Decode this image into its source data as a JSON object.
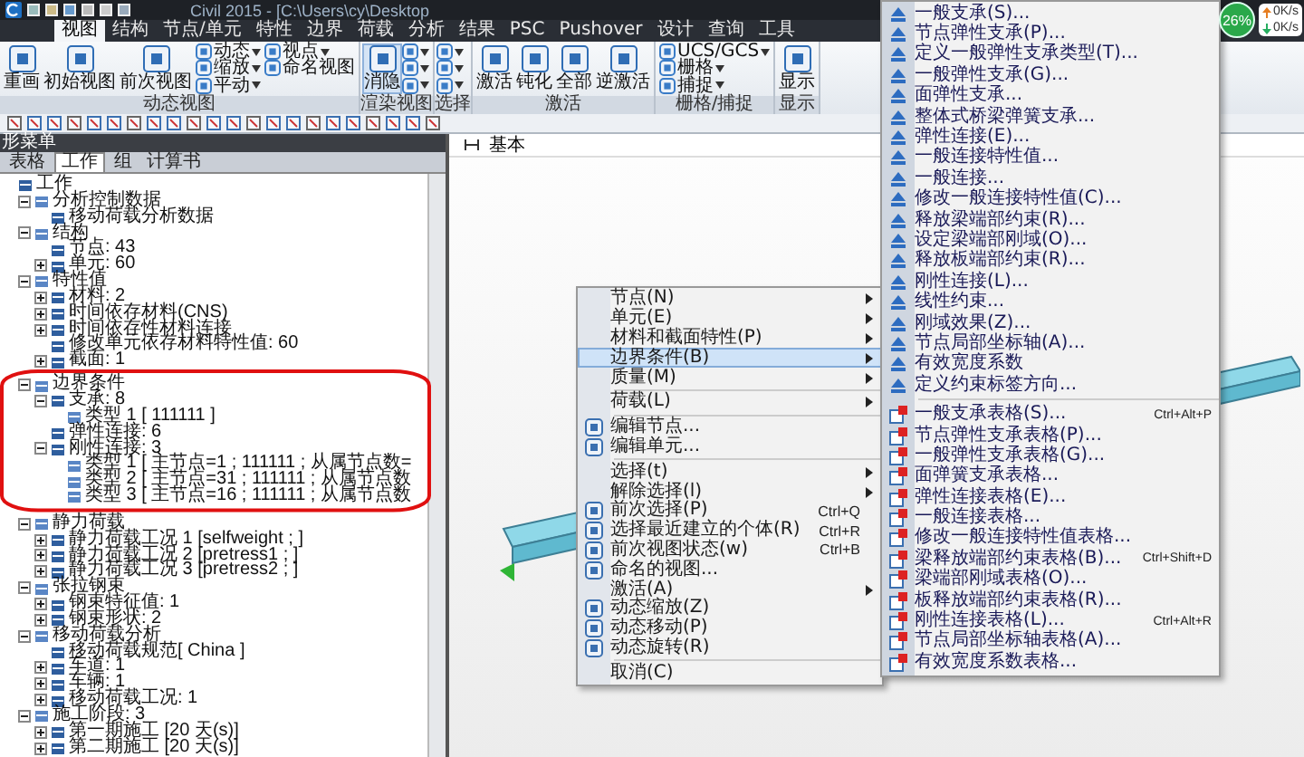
{
  "window": {
    "title": "Civil 2015 - [C:\\Users\\cy\\Desktop"
  },
  "system_widget": {
    "load": "26%",
    "upload": "0K/s",
    "download": "0K/s"
  },
  "ribbon": {
    "tabs": [
      {
        "label": "视图",
        "selected": true
      },
      {
        "label": "结构",
        "selected": false
      },
      {
        "label": "节点/单元",
        "selected": false
      },
      {
        "label": "特性",
        "selected": false
      },
      {
        "label": "边界",
        "selected": false
      },
      {
        "label": "荷载",
        "selected": false
      },
      {
        "label": "分析",
        "selected": false
      },
      {
        "label": "结果",
        "selected": false
      },
      {
        "label": "PSC",
        "selected": false
      },
      {
        "label": "Pushover",
        "selected": false
      },
      {
        "label": "设计",
        "selected": false
      },
      {
        "label": "查询",
        "selected": false
      },
      {
        "label": "工具",
        "selected": false
      }
    ],
    "groups": [
      {
        "label": "动态视图",
        "items": [
          {
            "kind": "large",
            "label": "重画",
            "selected": false
          },
          {
            "kind": "large",
            "label": "初始视图",
            "selected": false
          },
          {
            "kind": "large",
            "label": "前次视图",
            "selected": false
          },
          {
            "kind": "small",
            "label": "动态",
            "dropdown": true
          },
          {
            "kind": "small",
            "label": "缩放",
            "dropdown": true
          },
          {
            "kind": "small",
            "label": "平动",
            "dropdown": true
          },
          {
            "kind": "small",
            "label": "视点",
            "dropdown": true
          },
          {
            "kind": "small",
            "label": "命名视图",
            "dropdown": false
          }
        ]
      },
      {
        "label": "渲染视图",
        "items": [
          {
            "kind": "large",
            "label": "消隐",
            "selected": true
          },
          {
            "kind": "icon"
          },
          {
            "kind": "icon"
          },
          {
            "kind": "icon"
          }
        ]
      },
      {
        "label": "选择",
        "items": [
          {
            "kind": "icon"
          },
          {
            "kind": "icon"
          },
          {
            "kind": "icon"
          }
        ]
      },
      {
        "label": "激活",
        "items": [
          {
            "kind": "large",
            "label": "激活",
            "selected": false
          },
          {
            "kind": "large",
            "label": "钝化",
            "selected": false
          },
          {
            "kind": "large",
            "label": "全部",
            "selected": false
          },
          {
            "kind": "large",
            "label": "逆激活",
            "selected": false
          }
        ]
      },
      {
        "label": "栅格/捕捉",
        "items": [
          {
            "kind": "small",
            "label": "UCS/GCS",
            "dropdown": true
          },
          {
            "kind": "small",
            "label": "栅格",
            "dropdown": true
          },
          {
            "kind": "small",
            "label": "捕捉",
            "dropdown": true
          }
        ]
      },
      {
        "label": "显示",
        "items": [
          {
            "kind": "large",
            "label": "显示",
            "selected": false
          }
        ]
      }
    ]
  },
  "left_panel": {
    "title": "形菜单",
    "tabs": [
      {
        "label": "表格",
        "selected": false
      },
      {
        "label": "工作",
        "selected": true
      },
      {
        "label": "组",
        "selected": false
      },
      {
        "label": "计算书",
        "selected": false
      }
    ],
    "tree": [
      {
        "label": "工作",
        "children": [
          {
            "label": "分析控制数据",
            "expanded": true,
            "highlighted": false,
            "children": [
              {
                "label": "移动荷载分析数据"
              }
            ]
          },
          {
            "label": "结构",
            "expanded": true,
            "highlighted": false,
            "children": [
              {
                "label": "节点: 43"
              },
              {
                "label": "单元: 60",
                "expanded": false
              }
            ]
          },
          {
            "label": "特性值",
            "expanded": true,
            "highlighted": false,
            "children": [
              {
                "label": "材料: 2",
                "expanded": false
              },
              {
                "label": "时间依存材料(CNS)",
                "expanded": false
              },
              {
                "label": "时间依存性材料连接",
                "expanded": false
              },
              {
                "label": "修改单元依存材料特性值: 60"
              },
              {
                "label": "截面: 1",
                "expanded": false
              }
            ]
          },
          {
            "label": "边界条件",
            "expanded": true,
            "highlighted": true,
            "children": [
              {
                "label": "支承: 8",
                "expanded": true,
                "children": [
                  {
                    "label": "类型 1 [ 111111 ]"
                  }
                ]
              },
              {
                "label": "弹性连接: 6"
              },
              {
                "label": "刚性连接: 3",
                "expanded": true,
                "children": [
                  {
                    "label": "类型 1 [ 主节点=1 ; 111111 ; 从属节点数="
                  },
                  {
                    "label": "类型 2 [ 主节点=31 ; 111111 ; 从属节点数"
                  },
                  {
                    "label": "类型 3 [ 主节点=16 ; 111111 ; 从属节点数"
                  }
                ]
              }
            ]
          },
          {
            "label": "静力荷载",
            "expanded": true,
            "highlighted": false,
            "children": [
              {
                "label": "静力荷载工况 1 [selfweight ; ]",
                "expanded": false
              },
              {
                "label": "静力荷载工况 2 [pretress1 ; ]",
                "expanded": false
              },
              {
                "label": "静力荷载工况 3 [pretress2 ; ]",
                "expanded": false
              }
            ]
          },
          {
            "label": "张拉钢束",
            "expanded": true,
            "highlighted": false,
            "children": [
              {
                "label": "钢束特征值: 1",
                "expanded": false
              },
              {
                "label": "钢束形状: 2",
                "expanded": false
              }
            ]
          },
          {
            "label": "移动荷载分析",
            "expanded": true,
            "highlighted": false,
            "children": [
              {
                "label": "移动荷载规范[ China ]"
              },
              {
                "label": "车道: 1",
                "expanded": false
              },
              {
                "label": "车辆: 1",
                "expanded": false
              },
              {
                "label": "移动荷载工况: 1",
                "expanded": false
              }
            ]
          },
          {
            "label": "施工阶段: 3",
            "expanded": true,
            "highlighted": false,
            "children": [
              {
                "label": "第一期施工 [20 天(s)]",
                "expanded": false
              },
              {
                "label": "第二期施工 [20 天(s)]",
                "expanded": false
              }
            ]
          }
        ]
      }
    ]
  },
  "viewport": {
    "tab": "基本"
  },
  "context_menu": {
    "items": [
      {
        "kind": "item",
        "label": "节点(N)",
        "submenu": true,
        "icon": false,
        "selected": false
      },
      {
        "kind": "item",
        "label": "单元(E)",
        "submenu": true,
        "icon": false,
        "selected": false
      },
      {
        "kind": "item",
        "label": "材料和截面特性(P)",
        "submenu": true,
        "icon": false,
        "selected": false
      },
      {
        "kind": "item",
        "label": "边界条件(B)",
        "submenu": true,
        "icon": false,
        "selected": true
      },
      {
        "kind": "item",
        "label": "质量(M)",
        "submenu": true,
        "icon": false,
        "selected": false
      },
      {
        "kind": "separator"
      },
      {
        "kind": "item",
        "label": "荷载(L)",
        "submenu": true,
        "icon": false,
        "selected": false
      },
      {
        "kind": "separator"
      },
      {
        "kind": "item",
        "label": "编辑节点...",
        "submenu": false,
        "icon": true,
        "selected": false
      },
      {
        "kind": "item",
        "label": "编辑单元...",
        "submenu": false,
        "icon": true,
        "selected": false
      },
      {
        "kind": "separator"
      },
      {
        "kind": "item",
        "label": "选择(t)",
        "submenu": true,
        "icon": false,
        "selected": false
      },
      {
        "kind": "item",
        "label": "解除选择(l)",
        "submenu": true,
        "icon": false,
        "selected": false
      },
      {
        "kind": "item",
        "label": "前次选择(P)",
        "shortcut": "Ctrl+Q",
        "submenu": false,
        "icon": true,
        "selected": false
      },
      {
        "kind": "item",
        "label": "选择最近建立的个体(R)",
        "shortcut": "Ctrl+R",
        "submenu": false,
        "icon": true,
        "selected": false
      },
      {
        "kind": "item",
        "label": "前次视图状态(w)",
        "shortcut": "Ctrl+B",
        "submenu": false,
        "icon": true,
        "selected": false
      },
      {
        "kind": "item",
        "label": "命名的视图...",
        "submenu": false,
        "icon": true,
        "selected": false
      },
      {
        "kind": "item",
        "label": "激活(A)",
        "submenu": true,
        "icon": false,
        "selected": false
      },
      {
        "kind": "item",
        "label": "动态缩放(Z)",
        "submenu": false,
        "icon": true,
        "selected": false
      },
      {
        "kind": "item",
        "label": "动态移动(P)",
        "submenu": false,
        "icon": true,
        "selected": false
      },
      {
        "kind": "item",
        "label": "动态旋转(R)",
        "submenu": false,
        "icon": true,
        "selected": false
      },
      {
        "kind": "separator"
      },
      {
        "kind": "item",
        "label": "取消(C)",
        "submenu": false,
        "icon": false,
        "selected": false
      }
    ]
  },
  "submenu": {
    "items": [
      {
        "kind": "item",
        "label": "一般支承(S)..."
      },
      {
        "kind": "item",
        "label": "节点弹性支承(P)..."
      },
      {
        "kind": "item",
        "label": "定义一般弹性支承类型(T)..."
      },
      {
        "kind": "item",
        "label": "一般弹性支承(G)..."
      },
      {
        "kind": "item",
        "label": "面弹性支承..."
      },
      {
        "kind": "item",
        "label": "整体式桥梁弹簧支承..."
      },
      {
        "kind": "item",
        "label": "弹性连接(E)..."
      },
      {
        "kind": "item",
        "label": "一般连接特性值..."
      },
      {
        "kind": "item",
        "label": "一般连接..."
      },
      {
        "kind": "item",
        "label": "修改一般连接特性值(C)..."
      },
      {
        "kind": "item",
        "label": "释放梁端部约束(R)..."
      },
      {
        "kind": "item",
        "label": "设定梁端部刚域(O)..."
      },
      {
        "kind": "item",
        "label": "释放板端部约束(R)..."
      },
      {
        "kind": "item",
        "label": "刚性连接(L)..."
      },
      {
        "kind": "item",
        "label": "线性约束..."
      },
      {
        "kind": "item",
        "label": "刚域效果(Z)..."
      },
      {
        "kind": "item",
        "label": "节点局部坐标轴(A)..."
      },
      {
        "kind": "item",
        "label": "有效宽度系数"
      },
      {
        "kind": "item",
        "label": "定义约束标签方向..."
      },
      {
        "kind": "separator"
      },
      {
        "kind": "item",
        "label": "一般支承表格(S)...",
        "shortcut": "Ctrl+Alt+P"
      },
      {
        "kind": "item",
        "label": "节点弹性支承表格(P)..."
      },
      {
        "kind": "item",
        "label": "一般弹性支承表格(G)..."
      },
      {
        "kind": "item",
        "label": "面弹簧支承表格..."
      },
      {
        "kind": "item",
        "label": "弹性连接表格(E)..."
      },
      {
        "kind": "item",
        "label": "一般连接表格..."
      },
      {
        "kind": "item",
        "label": "修改一般连接特性值表格..."
      },
      {
        "kind": "item",
        "label": "梁释放端部约束表格(B)...",
        "shortcut": "Ctrl+Shift+D"
      },
      {
        "kind": "item",
        "label": "梁端部刚域表格(O)..."
      },
      {
        "kind": "item",
        "label": "板释放端部约束表格(R)..."
      },
      {
        "kind": "item",
        "label": "刚性连接表格(L)...",
        "shortcut": "Ctrl+Alt+R"
      },
      {
        "kind": "item",
        "label": "节点局部坐标轴表格(A)..."
      },
      {
        "kind": "item",
        "label": "有效宽度系数表格..."
      }
    ]
  }
}
